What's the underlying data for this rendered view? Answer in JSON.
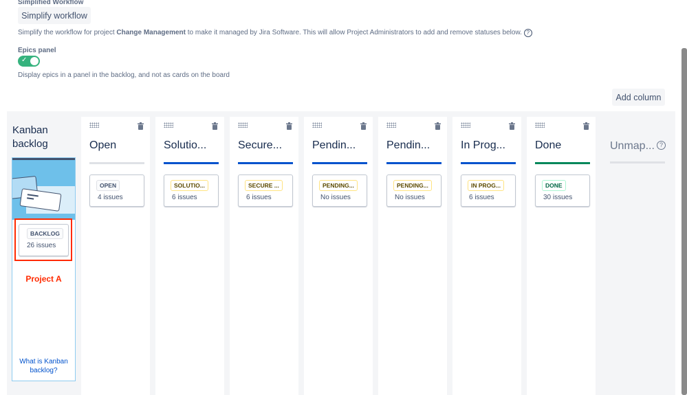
{
  "simplified": {
    "label": "Simplified Workflow",
    "button": "Simplify workflow",
    "desc_pre": "Simplify the workflow for project ",
    "desc_project": "Change Management",
    "desc_post": " to make it managed by Jira Software. This will allow Project Administrators to add and remove statuses below."
  },
  "epics": {
    "label": "Epics panel",
    "toggle_on": true,
    "desc": "Display epics in a panel in the backlog, and not as cards on the board"
  },
  "add_column": "Add column",
  "backlog": {
    "title": "Kanban backlog",
    "status": "BACKLOG",
    "count": "26 issues",
    "annotation": "Project A",
    "help_link": "What is Kanban backlog?"
  },
  "columns": [
    {
      "title": "Open",
      "status": "OPEN",
      "count": "4 issues",
      "bar": "#dfe1e6",
      "lozenge": "default"
    },
    {
      "title": "Solutio...",
      "status": "SOLUTIO...",
      "count": "6 issues",
      "bar": "#0052cc",
      "lozenge": "yellow"
    },
    {
      "title": "Secure...",
      "status": "SECURE ...",
      "count": "6 issues",
      "bar": "#0052cc",
      "lozenge": "yellow"
    },
    {
      "title": "Pendin...",
      "status": "PENDING...",
      "count": "No issues",
      "bar": "#0052cc",
      "lozenge": "yellow"
    },
    {
      "title": "Pendin...",
      "status": "PENDING...",
      "count": "No issues",
      "bar": "#0052cc",
      "lozenge": "yellow"
    },
    {
      "title": "In Prog...",
      "status": "IN PROG...",
      "count": "6 issues",
      "bar": "#0052cc",
      "lozenge": "yellow"
    },
    {
      "title": "Done",
      "status": "DONE",
      "count": "30 issues",
      "bar": "#00875a",
      "lozenge": "green"
    }
  ],
  "unmapped": {
    "title": "Unmap..."
  },
  "colors": {
    "toggle": "#36b37e",
    "annotation": "#ff2a00",
    "link": "#0052cc"
  }
}
